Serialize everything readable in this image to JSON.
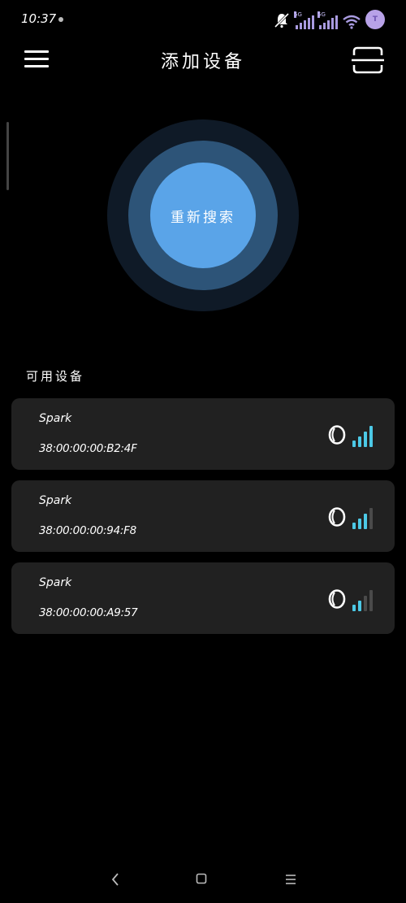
{
  "status_bar": {
    "time": "10:37",
    "network_1": "5G",
    "network_2": "5G",
    "avatar_text": "T"
  },
  "header": {
    "title": "添加设备",
    "menu_icon": "hamburger-menu-icon",
    "scan_icon": "scan-frame-icon"
  },
  "scan": {
    "button_label": "重新搜索",
    "ring_outer_color": "#0f1a27",
    "ring_middle_color": "#2d5478",
    "button_color": "#5aa4e8"
  },
  "devices_section": {
    "title": "可用设备"
  },
  "devices": [
    {
      "name": "Spark",
      "mac": "38:00:00:00:B2:4F",
      "signal_level": 4
    },
    {
      "name": "Spark",
      "mac": "38:00:00:00:94:F8",
      "signal_level": 3
    },
    {
      "name": "Spark",
      "mac": "38:00:00:00:A9:57",
      "signal_level": 2
    }
  ],
  "colors": {
    "background": "#000000",
    "card": "#212121",
    "signal_active": "#4cc9e6",
    "signal_inactive": "#4a4a4a",
    "accent": "#5aa4e8"
  },
  "nav": {
    "back_icon": "back-chevron-icon",
    "home_icon": "home-square-icon",
    "recents_icon": "recents-menu-icon"
  }
}
